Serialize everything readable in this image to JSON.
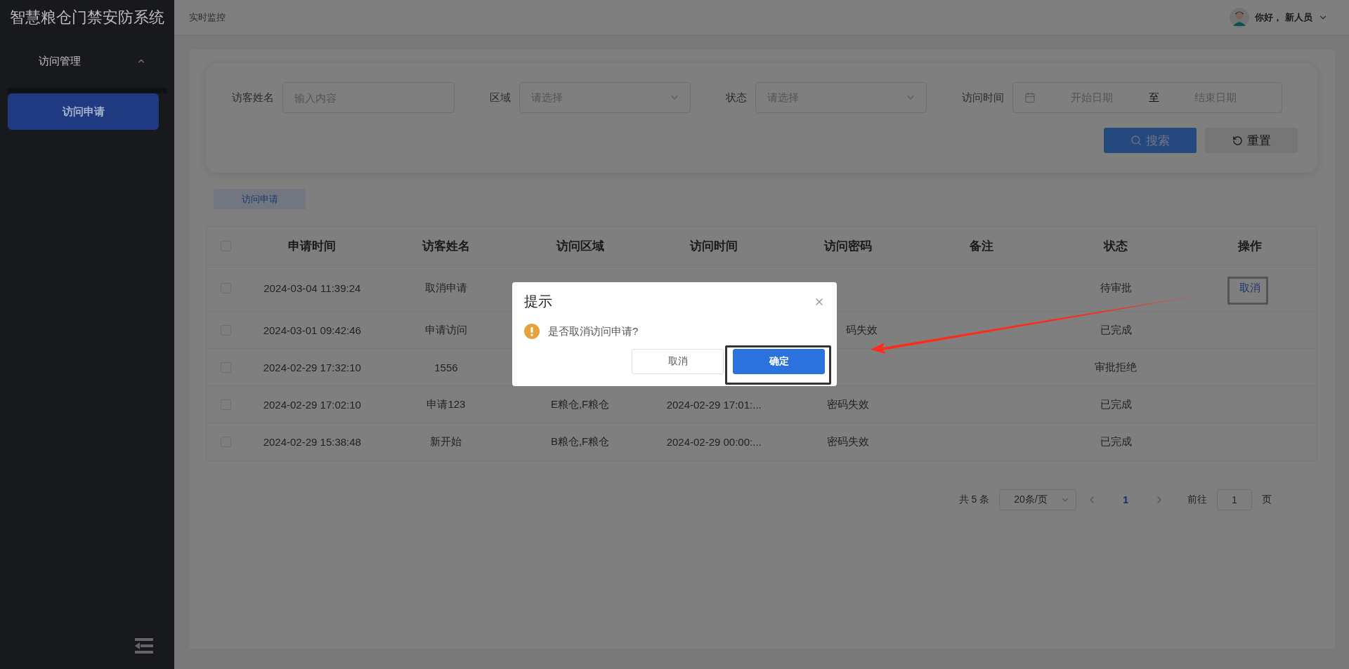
{
  "sidebar": {
    "title": "智慧粮仓门禁安防系统",
    "groups": [
      {
        "label": "访问管理",
        "expanded": true,
        "items": [
          {
            "label": "访问申请",
            "selected": true
          }
        ]
      }
    ]
  },
  "header": {
    "breadcrumb": "实时监控",
    "user": "你好， 新人员"
  },
  "filters": [
    {
      "kind": "input",
      "label": "访客姓名",
      "placeholder": "输入内容"
    },
    {
      "kind": "select",
      "label": "区域",
      "placeholder": "请选择"
    },
    {
      "kind": "select",
      "label": "状态",
      "placeholder": "请选择"
    },
    {
      "kind": "daterange",
      "label": "访问时间",
      "start_placeholder": "开始日期",
      "separator": "至",
      "end_placeholder": "结束日期"
    }
  ],
  "buttons": [
    {
      "kind": "primary",
      "label": "搜索"
    },
    {
      "kind": "reset",
      "label": "重置"
    }
  ],
  "tabs": [
    {
      "label": "访问申请",
      "selected": true
    }
  ],
  "table": {
    "header_checked": false,
    "columns": [
      "申请时间",
      "访客姓名",
      "访问区域",
      "访问时间",
      "访问密码",
      "备注",
      "状态",
      "操作"
    ],
    "rows": [
      {
        "checked": false,
        "cells": [
          "2024-03-04 11:39:24",
          "取消申请",
          null,
          null,
          null,
          null,
          "待审批"
        ],
        "action": "取消"
      },
      {
        "checked": false,
        "cells": [
          "2024-03-01 09:42:46",
          "申请访问",
          null,
          null,
          {
            "text": "码失效",
            "kind": "cut"
          },
          null,
          "已完成"
        ]
      },
      {
        "checked": false,
        "cells": [
          "2024-02-29 17:32:10",
          "1556",
          null,
          null,
          null,
          null,
          "审批拒绝"
        ]
      },
      {
        "checked": false,
        "cells": [
          "2024-02-29 17:02:10",
          "申请123",
          "E粮仓,F粮仓",
          "2024-02-29 17:01:...",
          "密码失效",
          null,
          "已完成"
        ]
      },
      {
        "checked": false,
        "cells": [
          "2024-02-29 15:38:48",
          "新开始",
          "B粮仓,F粮仓",
          "2024-02-29 00:00:...",
          "密码失效",
          null,
          "已完成"
        ]
      }
    ]
  },
  "pagination": {
    "total": "共 5 条",
    "page_size": "20条/页",
    "pages": [
      {
        "label": "1",
        "selected": true
      }
    ],
    "goto_label": "前往",
    "goto_value": "1",
    "goto_suffix": "页"
  },
  "dialog": {
    "title": "提示",
    "message": "是否取消访问申请?",
    "buttons": [
      {
        "kind": "default",
        "label": "取消"
      },
      {
        "kind": "primary",
        "label": "确定"
      }
    ]
  }
}
